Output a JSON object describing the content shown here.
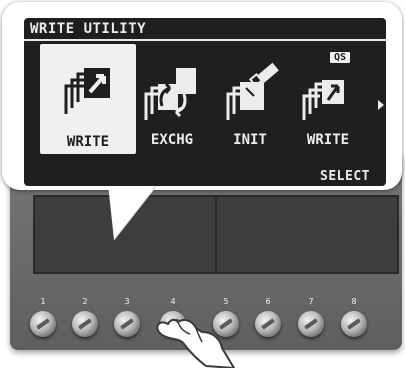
{
  "lcd": {
    "title": "WRITE UTILITY",
    "select_label": "SELECT",
    "menu": [
      {
        "label": "WRITE",
        "icon": "write-icon",
        "selected": true
      },
      {
        "label": "EXCHG",
        "icon": "exchange-icon",
        "selected": false
      },
      {
        "label": "INIT",
        "icon": "init-icon",
        "selected": false
      },
      {
        "label": "WRITE",
        "icon": "quick-setup-write-icon",
        "badge": "QS",
        "selected": false
      }
    ]
  },
  "knobs": {
    "numbers": [
      "1",
      "2",
      "3",
      "4",
      "5",
      "6",
      "7",
      "8"
    ],
    "active_knob": "4"
  },
  "colors": {
    "lcd_background": "#1f1f1f",
    "lcd_text": "#ececec",
    "device_panel": "#6b6b6b",
    "knob_silver": "#b9b9b9"
  }
}
